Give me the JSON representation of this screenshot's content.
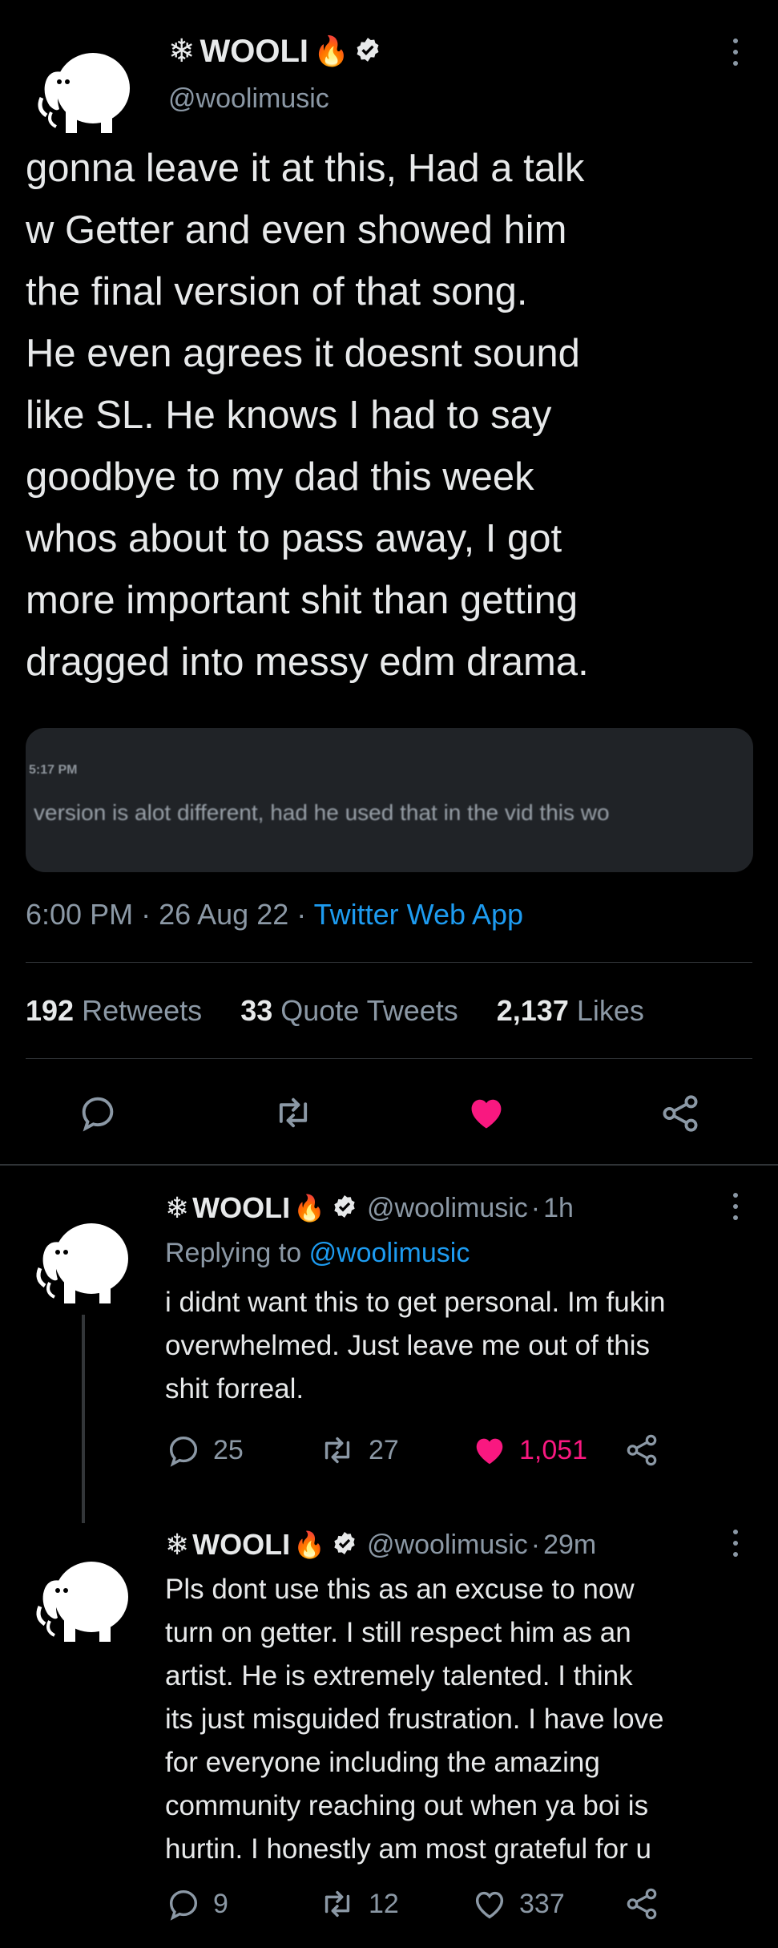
{
  "main_tweet": {
    "display_name": "WOOLI",
    "handle": "@woolimusic",
    "text_lines": [
      "gonna leave it at this, Had a talk",
      "w Getter and even showed him",
      "the final version of that song.",
      "He even agrees it doesnt sound",
      "like SL. He knows I had to say",
      "goodbye to my dad this week",
      "whos about to pass away, I got",
      "more important shit than getting",
      "dragged into messy edm drama."
    ],
    "embedded": {
      "time": "5:17 PM",
      "text": "version is alot different, had he used that in the vid this wo"
    },
    "time": "6:00 PM",
    "date": "26 Aug 22",
    "source": "Twitter Web App",
    "stats": {
      "retweets": "192",
      "retweets_label": "Retweets",
      "quotes": "33",
      "quotes_label": "Quote Tweets",
      "likes": "2,137",
      "likes_label": "Likes"
    },
    "colors": {
      "like": "#f91880",
      "link": "#1d9bf0"
    }
  },
  "replies": [
    {
      "display_name": "WOOLI",
      "handle": "@woolimusic",
      "time": "1h",
      "replying_label": "Replying to",
      "replying_to": "@woolimusic",
      "text_lines": [
        "i didnt want this to get personal. Im fukin",
        "overwhelmed. Just leave me out of this",
        "shit forreal."
      ],
      "reply_count": "25",
      "retweet_count": "27",
      "like_count": "1,051",
      "liked": true
    },
    {
      "display_name": "WOOLI",
      "handle": "@woolimusic",
      "time": "29m",
      "text_lines": [
        "Pls dont use this as an excuse to now",
        "turn on getter. I still respect him as an",
        "artist. He is extremely talented. I think",
        "its just misguided frustration. I have love",
        "for everyone including the amazing",
        "community reaching out when ya boi is",
        "hurtin. I honestly am most grateful for u"
      ],
      "reply_count": "9",
      "retweet_count": "12",
      "like_count": "337",
      "liked": false
    }
  ],
  "icons": {
    "name_prefix": "snowflake-icon",
    "name_suffix": "fire-icon",
    "verified": "verified-badge-icon",
    "actions": [
      "reply-icon",
      "retweet-icon",
      "like-icon",
      "share-icon"
    ]
  }
}
